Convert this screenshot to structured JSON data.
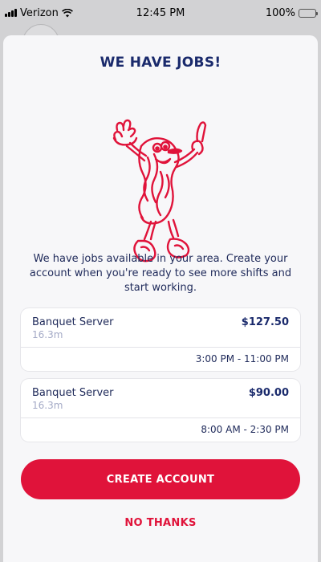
{
  "status_bar": {
    "carrier": "Verizon",
    "time": "12:45 PM",
    "battery": "100%"
  },
  "modal": {
    "title": "WE HAVE JOBS!",
    "description": "We have jobs available in your area. Create your account when you're ready to see more shifts and start working.",
    "jobs": [
      {
        "title": "Banquet Server",
        "distance": "16.3m",
        "pay": "$127.50",
        "hours": "3:00 PM - 11:00 PM"
      },
      {
        "title": "Banquet Server",
        "distance": "16.3m",
        "pay": "$90.00",
        "hours": "8:00 AM - 2:30 PM"
      }
    ],
    "create_account_label": "CREATE ACCOUNT",
    "no_thanks_label": "NO THANKS"
  },
  "colors": {
    "brand_red": "#e0133a",
    "navy": "#1a2a6c"
  },
  "icons": [
    "cellular-signal-icon",
    "wifi-icon",
    "battery-icon",
    "mascot-illustration"
  ]
}
